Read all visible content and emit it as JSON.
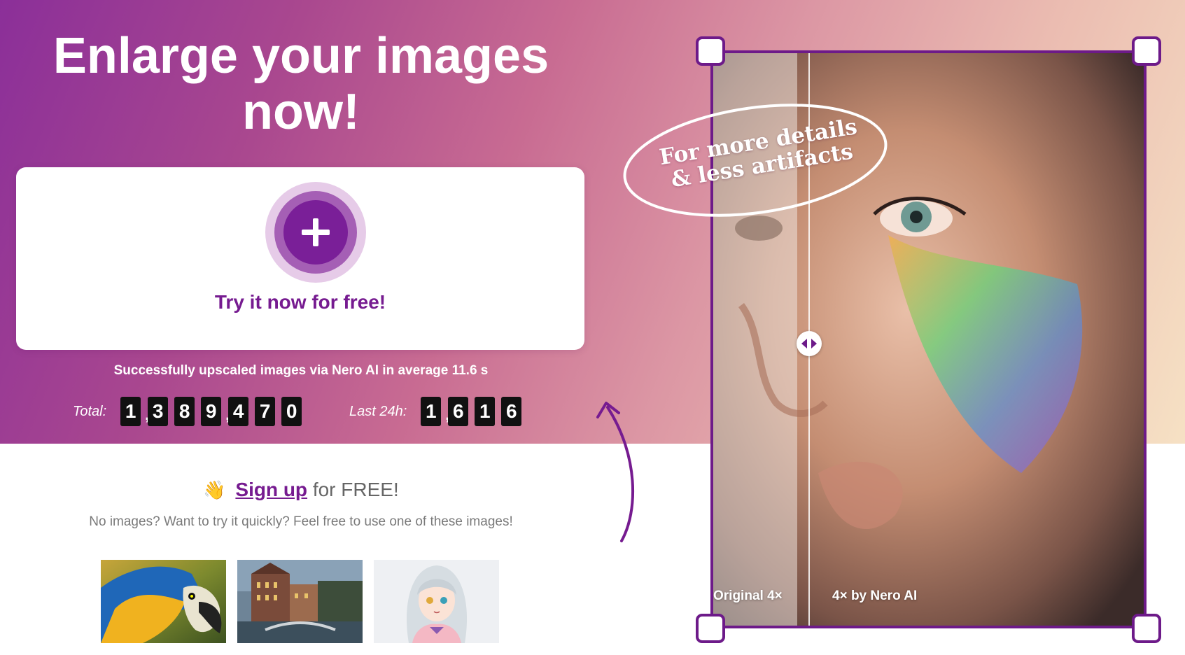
{
  "hero": {
    "headline": "Enlarge your images now!",
    "upload_cta": "Try it now for free!"
  },
  "stats": {
    "caption": "Successfully upscaled images via Nero AI in average 11.6 s",
    "total_label": "Total:",
    "total_digits": [
      "1",
      "3",
      "8",
      "9",
      "4",
      "7",
      "0"
    ],
    "last24_label": "Last 24h:",
    "last24_digits": [
      "1",
      "6",
      "1",
      "6"
    ]
  },
  "signup": {
    "emoji": "👋",
    "link_text": "Sign up",
    "suffix": "for FREE!",
    "hint": "No images? Want to try it quickly? Feel free to use one of these images!"
  },
  "samples": [
    {
      "name": "parrot"
    },
    {
      "name": "city-canal"
    },
    {
      "name": "anime-girl"
    }
  ],
  "comparison": {
    "callout": "For more details & less artifacts",
    "label_left": "Original 4×",
    "label_right": "4× by Nero AI"
  },
  "colors": {
    "brand_purple": "#761b90",
    "frame_purple": "#6d1a89",
    "counter_bg": "#111111"
  },
  "icons": [
    "plus-icon",
    "arrows-horizontal-icon",
    "curved-arrow-icon"
  ]
}
